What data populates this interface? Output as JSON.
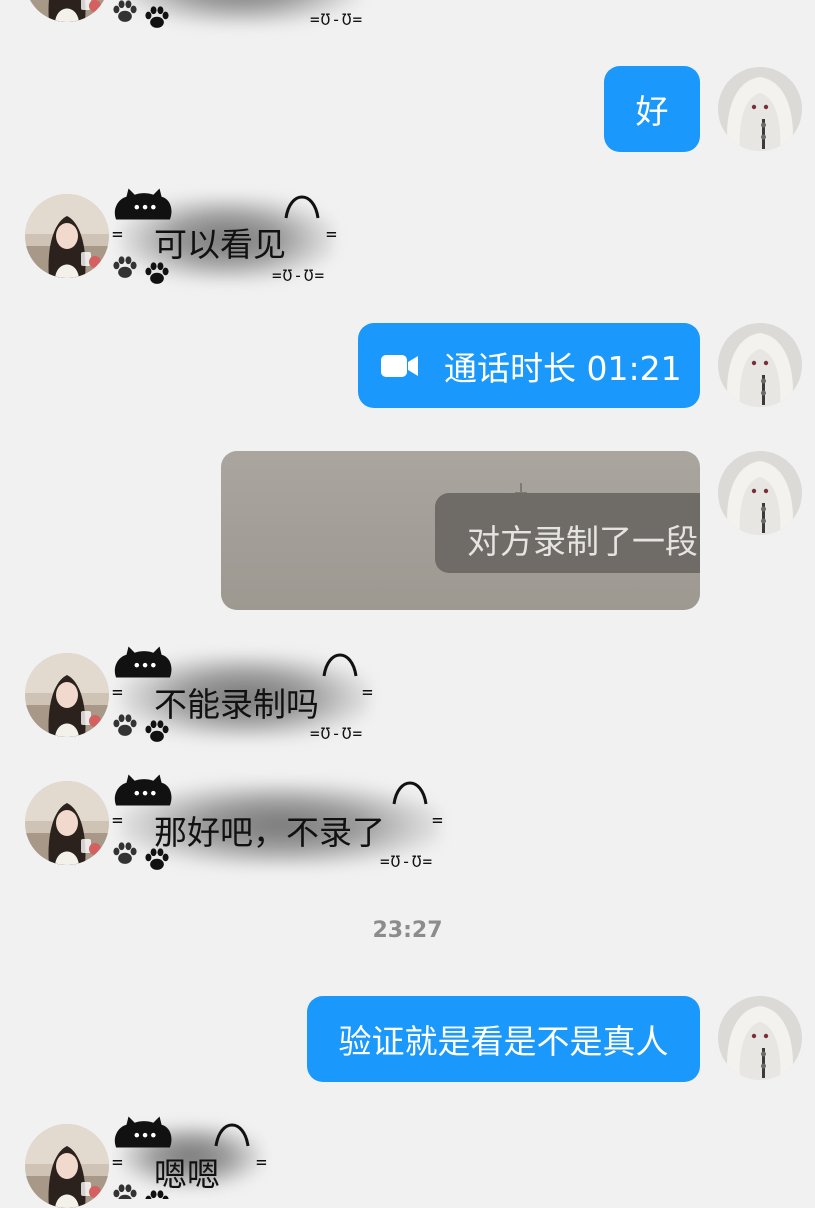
{
  "messages": {
    "ok": "好",
    "can_see": "可以看见",
    "call_duration": "通话时长 01:21",
    "video_overlay": "对方录制了一段",
    "cannot_record": "不能录制吗",
    "ok_no_record": "那好吧，不录了",
    "verify": "验证就是看是不是真人",
    "en_en": "嗯嗯"
  },
  "timestamp": "23:27",
  "decor": {
    "eq_left": "=",
    "eq_right": "=",
    "face": "=Ʊ-Ʊ="
  },
  "colors": {
    "background": "#f1f1f1",
    "outgoing_bubble": "#1a98fb",
    "outgoing_text": "#ffffff",
    "incoming_text": "#111111",
    "timestamp": "#8c8c8c"
  },
  "icons": {
    "call": "video-camera-icon",
    "paw": "paw-icon",
    "cat": "cat-head-icon"
  }
}
